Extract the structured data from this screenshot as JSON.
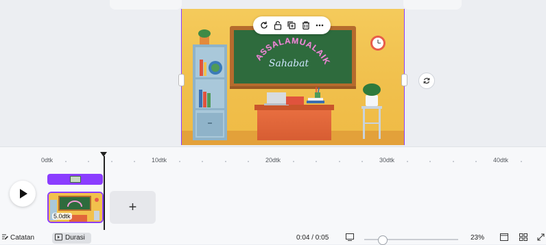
{
  "canvas": {
    "toolbar_icons": [
      "rotate-icon",
      "lock-icon",
      "duplicate-icon",
      "trash-icon",
      "more-icon"
    ],
    "refresh_icon": "refresh-icon",
    "scene": {
      "text_arc": "ASSALAMUALAIKUM",
      "text_script": "Sahabat"
    },
    "colors": {
      "wall": "#f2c14c",
      "chalkboard": "#2e6b3d",
      "board_frame": "#b56b2d",
      "desk": "#e2663a",
      "selection": "#8b3dff"
    }
  },
  "timeline": {
    "ticks": [
      "0dtk",
      "10dtk",
      "20dtk",
      "30dtk",
      "40dtk"
    ],
    "clip_duration": "5.0dtk",
    "add_label": "+"
  },
  "bottom_bar": {
    "notes_label": "Catatan",
    "duration_label": "Durasi",
    "time_readout": "0:04 / 0:05",
    "zoom_level": "23%",
    "zoom_value_fraction": 0.19
  }
}
